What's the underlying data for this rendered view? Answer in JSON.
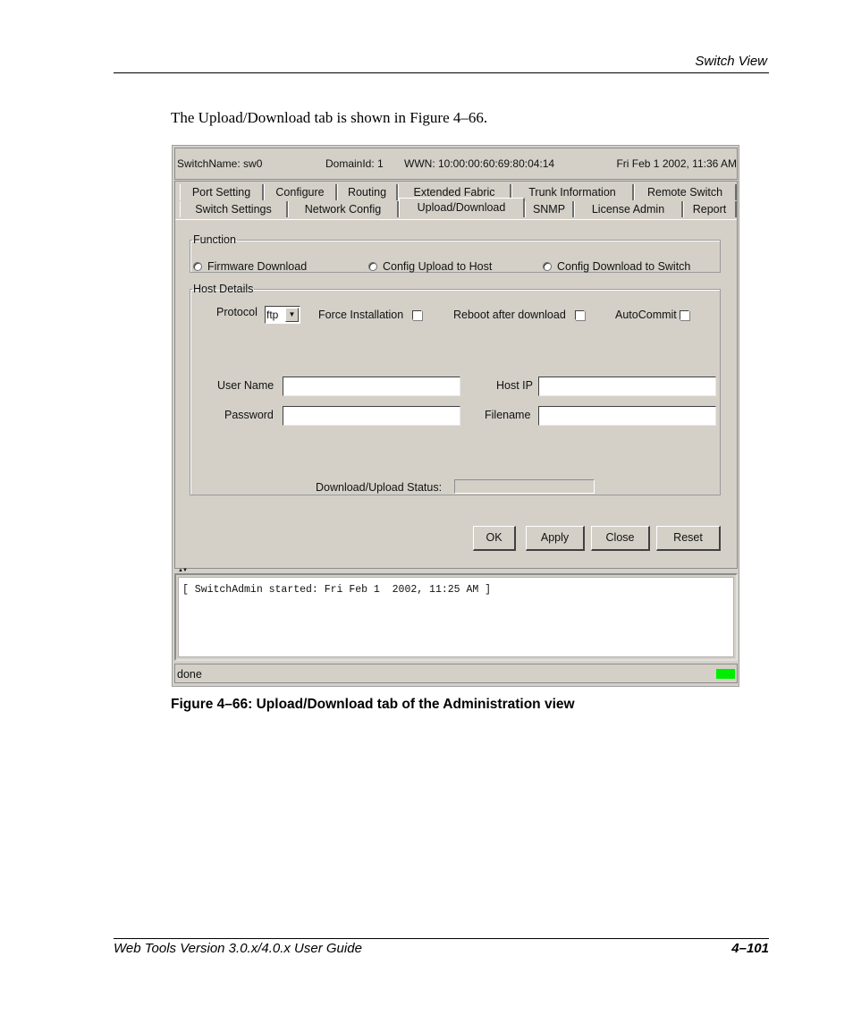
{
  "page": {
    "running_head": "Switch View",
    "intro_text": "The Upload/Download tab is shown in Figure 4–66.",
    "caption": "Figure 4–66:  Upload/Download tab of the Administration view",
    "footer_left": "Web Tools Version 3.0.x/4.0.x User Guide",
    "footer_right": "4–101"
  },
  "app": {
    "titlebar": {
      "switch_name": "SwitchName: sw0",
      "domain_id": "DomainId: 1",
      "wwn": "WWN: 10:00:00:60:69:80:04:14",
      "datetime": "Fri Feb 1  2002, 11:36 AM"
    },
    "tabs_row1": [
      {
        "label": "Port Setting"
      },
      {
        "label": "Configure"
      },
      {
        "label": "Routing"
      },
      {
        "label": "Extended Fabric"
      },
      {
        "label": "Trunk Information"
      },
      {
        "label": "Remote Switch"
      }
    ],
    "tabs_row2": [
      {
        "label": "Switch Settings"
      },
      {
        "label": "Network Config"
      },
      {
        "label": "Upload/Download",
        "active": true
      },
      {
        "label": "SNMP"
      },
      {
        "label": "License Admin"
      },
      {
        "label": "Report"
      }
    ],
    "function_group": {
      "legend": "Function",
      "options": [
        {
          "label": "Firmware Download",
          "selected": false
        },
        {
          "label": "Config Upload to Host",
          "selected": false
        },
        {
          "label": "Config Download to Switch",
          "selected": false
        }
      ]
    },
    "host_details": {
      "legend": "Host Details",
      "protocol_label": "Protocol",
      "protocol_value": "ftp",
      "force_installation_label": "Force Installation",
      "force_installation_checked": false,
      "reboot_label": "Reboot after download",
      "reboot_checked": false,
      "autocommit_label": "AutoCommit",
      "autocommit_checked": false,
      "user_name_label": "User Name",
      "user_name_value": "",
      "host_ip_label": "Host IP",
      "host_ip_value": "",
      "password_label": "Password",
      "password_value": "",
      "filename_label": "Filename",
      "filename_value": "",
      "status_label": "Download/Upload Status:",
      "status_progress": 0
    },
    "buttons": {
      "ok": "OK",
      "apply": "Apply",
      "close": "Close",
      "reset": "Reset"
    },
    "log": {
      "text": "[ SwitchAdmin started: Fri Feb 1  2002, 11:25 AM ]"
    },
    "statusbar": {
      "text": "done",
      "indicator_color": "#00ee00"
    }
  }
}
